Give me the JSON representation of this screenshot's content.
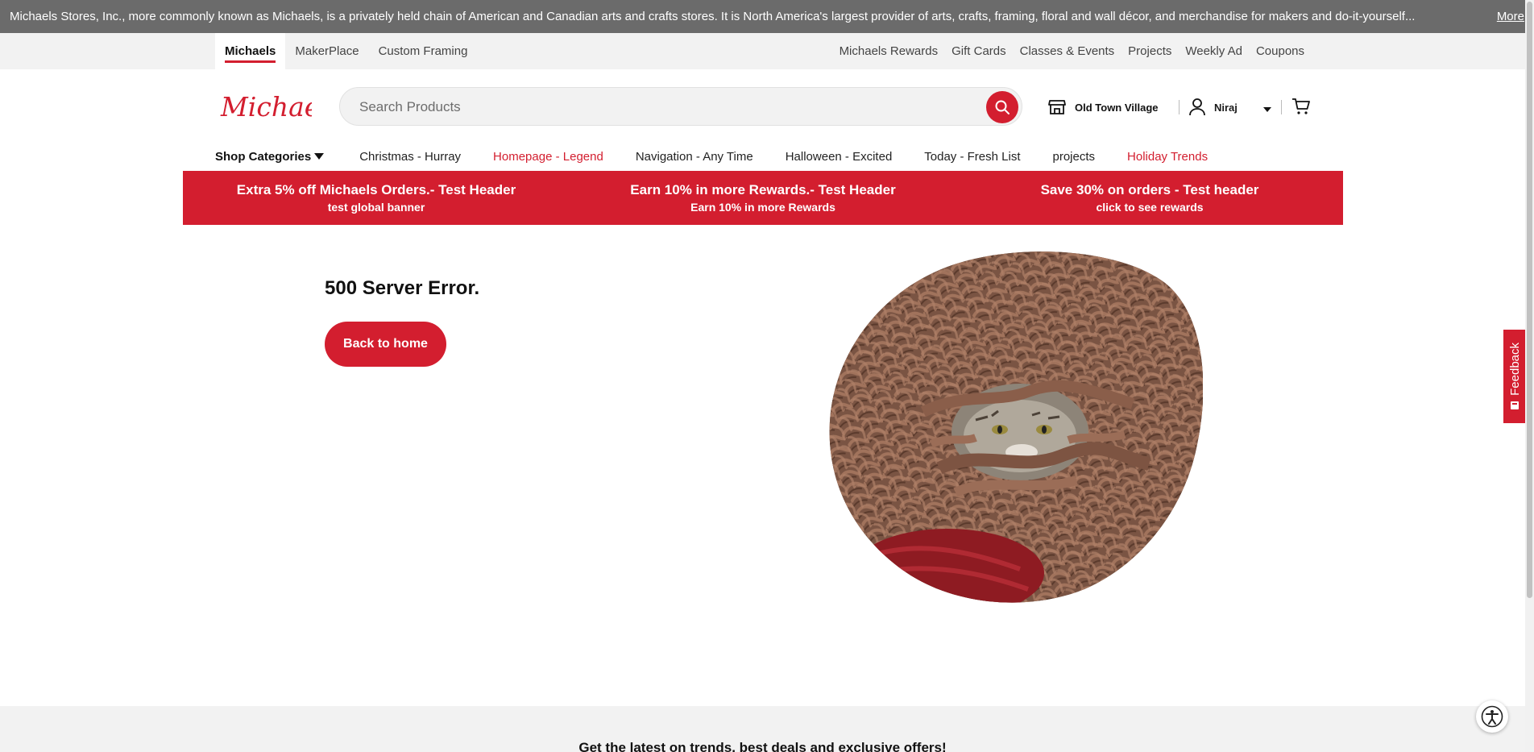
{
  "announcement": {
    "text": "Michaels Stores, Inc., more commonly known as Michaels, is a privately held chain of American and Canadian arts and crafts stores. It is North America's largest provider of arts, crafts, framing, floral and wall décor, and merchandise for makers and do-it-yourself...",
    "more_label": "More"
  },
  "utility_nav": {
    "tabs": [
      {
        "label": "Michaels",
        "active": true
      },
      {
        "label": "MakerPlace",
        "active": false
      },
      {
        "label": "Custom Framing",
        "active": false
      }
    ],
    "links": [
      "Michaels Rewards",
      "Gift Cards",
      "Classes & Events",
      "Projects",
      "Weekly Ad",
      "Coupons"
    ]
  },
  "header": {
    "logo_text": "Michaels",
    "search_placeholder": "Search Products",
    "store_name": "Old Town Village",
    "account_name": "Niraj"
  },
  "category_nav": {
    "shop_label": "Shop Categories",
    "items": [
      {
        "label": "Christmas - Hurray",
        "highlight": false
      },
      {
        "label": "Homepage - Legend",
        "highlight": true
      },
      {
        "label": "Navigation - Any Time",
        "highlight": false
      },
      {
        "label": "Halloween - Excited",
        "highlight": false
      },
      {
        "label": "Today - Fresh List",
        "highlight": false
      },
      {
        "label": "projects",
        "highlight": false
      },
      {
        "label": "Holiday Trends",
        "highlight": true
      }
    ]
  },
  "promo_banner": [
    {
      "title": "Extra 5% off Michaels Orders.- Test Header",
      "subtitle": "test global banner"
    },
    {
      "title": "Earn 10% in more Rewards.- Test Header",
      "subtitle": "Earn 10% in more Rewards"
    },
    {
      "title": "Save 30% on orders - Test header",
      "subtitle": "click to see rewards"
    }
  ],
  "error": {
    "title": "500 Server Error.",
    "button_label": "Back to home"
  },
  "feedback_label": "Feedback",
  "footer": {
    "signup_text": "Get the latest on trends, best deals and exclusive offers!"
  },
  "colors": {
    "brand_red": "#d31e2f",
    "announcement_bg": "#6b6b6b",
    "utility_bg": "#f2f2f2"
  },
  "icons": [
    "search-icon",
    "store-icon",
    "user-icon",
    "caret-down-icon",
    "cart-icon",
    "feedback-icon",
    "accessibility-icon"
  ]
}
